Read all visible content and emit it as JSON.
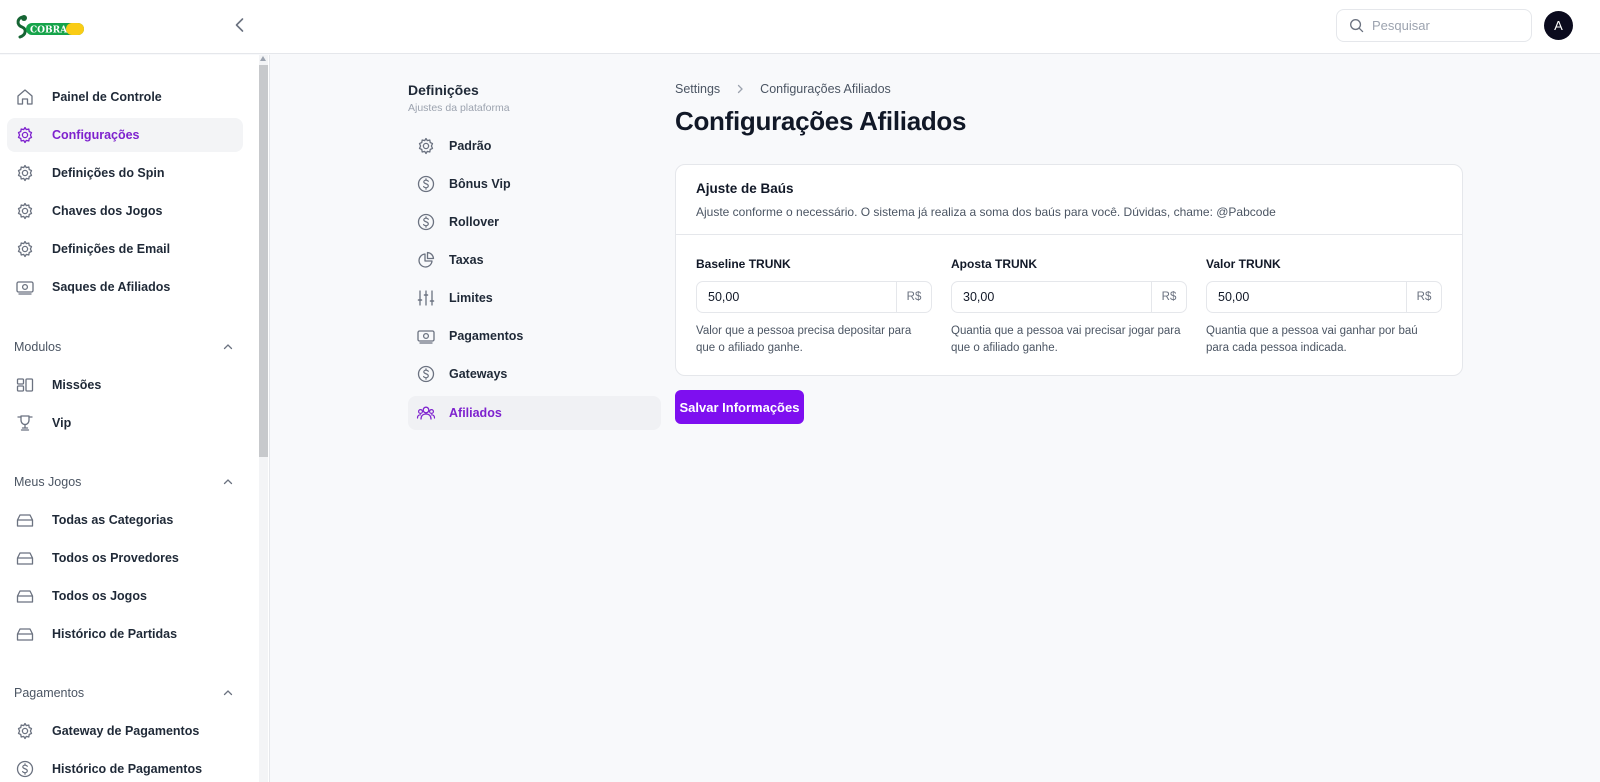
{
  "app": {
    "logo_text": "COBRA"
  },
  "header": {
    "search_placeholder": "Pesquisar",
    "avatar_initial": "A"
  },
  "sidebar": {
    "main_items": [
      {
        "label": "Painel de Controle",
        "icon": "home-icon"
      },
      {
        "label": "Configurações",
        "icon": "gear-icon",
        "active": true
      },
      {
        "label": "Definições do Spin",
        "icon": "gear-icon"
      },
      {
        "label": "Chaves dos Jogos",
        "icon": "gear-icon"
      },
      {
        "label": "Definições de Email",
        "icon": "gear-icon"
      },
      {
        "label": "Saques de Afiliados",
        "icon": "banknote-icon"
      }
    ],
    "sections": [
      {
        "title": "Modulos",
        "items": [
          {
            "label": "Missões",
            "icon": "dashboard-icon"
          },
          {
            "label": "Vip",
            "icon": "trophy-icon"
          }
        ]
      },
      {
        "title": "Meus Jogos",
        "items": [
          {
            "label": "Todas as Categorias",
            "icon": "inbox-icon"
          },
          {
            "label": "Todos os Provedores",
            "icon": "inbox-icon"
          },
          {
            "label": "Todos os Jogos",
            "icon": "inbox-icon"
          },
          {
            "label": "Histórico de Partidas",
            "icon": "inbox-icon"
          }
        ]
      },
      {
        "title": "Pagamentos",
        "items": [
          {
            "label": "Gateway de Pagamentos",
            "icon": "gear-icon"
          },
          {
            "label": "Histórico de Pagamentos",
            "icon": "dollar-icon"
          }
        ]
      }
    ]
  },
  "settings_nav": {
    "title": "Definições",
    "subtitle": "Ajustes da plataforma",
    "items": [
      {
        "label": "Padrão",
        "icon": "gear-icon"
      },
      {
        "label": "Bônus Vip",
        "icon": "dollar-icon"
      },
      {
        "label": "Rollover",
        "icon": "dollar-icon"
      },
      {
        "label": "Taxas",
        "icon": "pie-chart-icon"
      },
      {
        "label": "Limites",
        "icon": "sliders-icon"
      },
      {
        "label": "Pagamentos",
        "icon": "banknote-icon"
      },
      {
        "label": "Gateways",
        "icon": "dollar-icon"
      },
      {
        "label": "Afiliados",
        "icon": "users-icon",
        "active": true
      }
    ]
  },
  "main": {
    "breadcrumb": [
      "Settings",
      "Configurações Afiliados"
    ],
    "title": "Configurações Afiliados",
    "card": {
      "title": "Ajuste de Baús",
      "description": "Ajuste conforme o necessário. O sistema já realiza a soma dos baús para você. Dúvidas, chame: @Pabcode",
      "fields": [
        {
          "label": "Baseline TRUNK",
          "value": "50,00",
          "addon": "R$",
          "help": "Valor que a pessoa precisa depositar para que o afiliado ganhe."
        },
        {
          "label": "Aposta TRUNK",
          "value": "30,00",
          "addon": "R$",
          "help": "Quantia que a pessoa vai precisar jogar para que o afiliado ganhe."
        },
        {
          "label": "Valor TRUNK",
          "value": "50,00",
          "addon": "R$",
          "help": "Quantia que a pessoa vai ganhar por baú para cada pessoa indicada."
        }
      ]
    },
    "save_label": "Salvar Informações"
  },
  "colors": {
    "accent": "#7e0ff0",
    "active_text": "#7e22ce",
    "avatar_bg": "#0b0b1e",
    "logo_green": "#15803d"
  }
}
